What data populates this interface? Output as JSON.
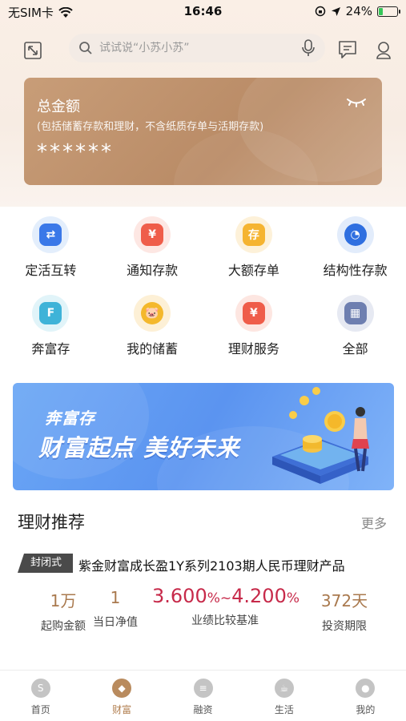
{
  "status_bar": {
    "carrier": "无SIM卡",
    "time": "16:46",
    "battery": "24%",
    "battery_level": 0.24
  },
  "header": {
    "search_placeholder": "试试说“小苏小苏”"
  },
  "balance_card": {
    "title": "总金额",
    "subtitle": "(包括储蓄存款和理财，不含纸质存单与活期存款)",
    "amount": "******"
  },
  "services": [
    {
      "label": "定活互转",
      "icon": "exchange-icon",
      "color": "#3a78e8",
      "bg": "#e3eefc"
    },
    {
      "label": "通知存款",
      "icon": "notice-deposit-icon",
      "color": "#ef5d4a",
      "bg": "#fde7e3"
    },
    {
      "label": "大额存单",
      "icon": "certificate-icon",
      "color": "#f5b431",
      "bg": "#fdf1d9"
    },
    {
      "label": "结构性存款",
      "icon": "pie-chart-icon",
      "color": "#2f6fe0",
      "bg": "#e2ecfb"
    },
    {
      "label": "奔富存",
      "icon": "benfu-icon",
      "color": "#3fb3d8",
      "bg": "#e1f4f9"
    },
    {
      "label": "我的储蓄",
      "icon": "piggy-bank-icon",
      "color": "#f4b82c",
      "bg": "#fdf0d6"
    },
    {
      "label": "理财服务",
      "icon": "finance-service-icon",
      "color": "#ef5d4a",
      "bg": "#fde6e1"
    },
    {
      "label": "全部",
      "icon": "all-apps-icon",
      "color": "#6e7fb0",
      "bg": "#e6e9f2"
    }
  ],
  "banner": {
    "brand": "奔富存",
    "slogan": "财富起点 美好未来"
  },
  "recommendations": {
    "title": "理财推荐",
    "more": "更多",
    "product": {
      "tag": "封闭式",
      "name": "紫金财富成长盈1Y系列2103期人民币理财产品",
      "min_amount": "1万",
      "min_amount_label": "起购金额",
      "nav": "1",
      "nav_label": "当日净值",
      "rate_low": "3.600",
      "rate_high": "4.200",
      "rate_label": "业绩比较基准",
      "term": "372天",
      "term_label": "投资期限"
    }
  },
  "tab_bar": [
    {
      "label": "首页",
      "icon": "home-icon",
      "active": false
    },
    {
      "label": "财富",
      "icon": "wealth-icon",
      "active": true
    },
    {
      "label": "融资",
      "icon": "loan-icon",
      "active": false
    },
    {
      "label": "生活",
      "icon": "life-icon",
      "active": false
    },
    {
      "label": "我的",
      "icon": "profile-icon",
      "active": false
    }
  ],
  "colors": {
    "accent": "#b98b5e",
    "rate": "#c72a4a",
    "card": "#c09471"
  }
}
